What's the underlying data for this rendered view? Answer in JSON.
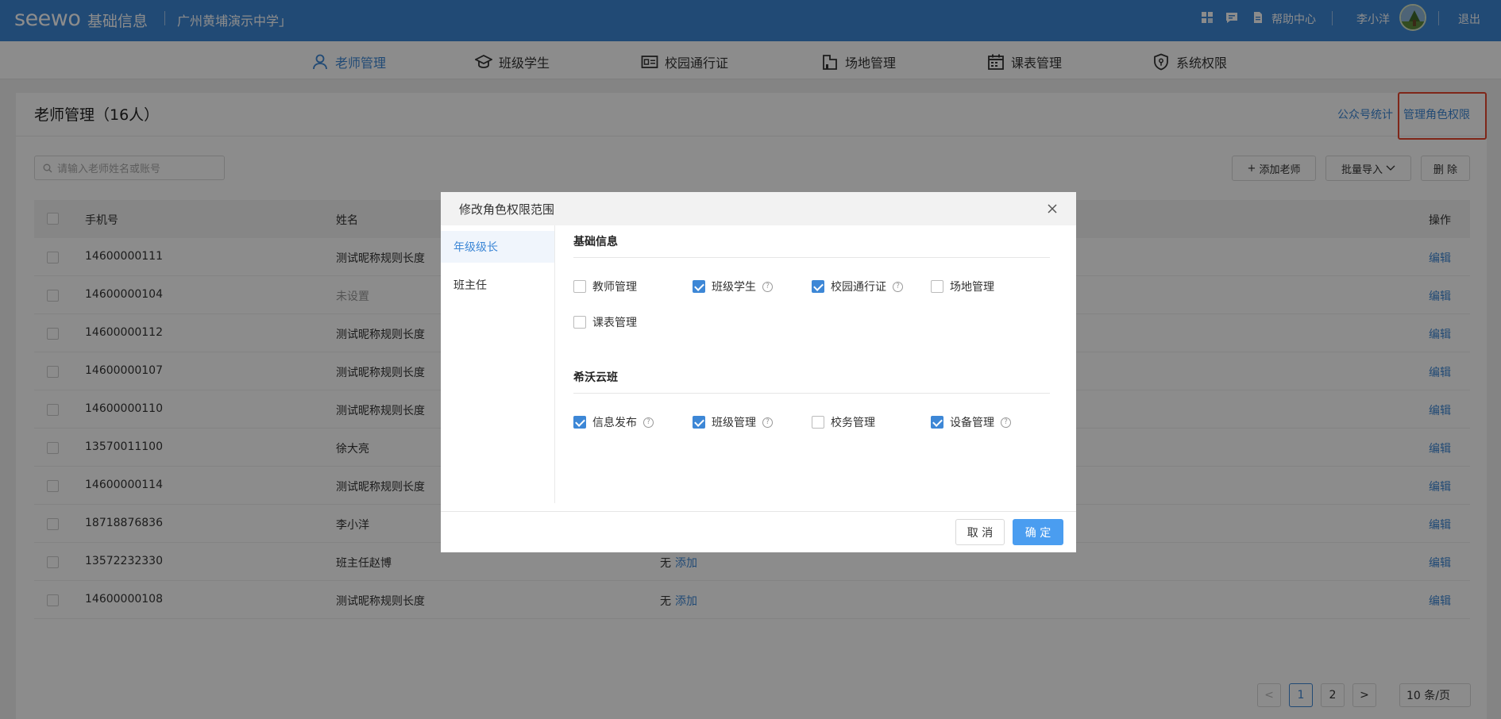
{
  "topbar": {
    "logo": "seewo",
    "app_name": "基础信息",
    "school": "广州黄埔演示中学」",
    "help": "帮助中心",
    "user": "李小洋",
    "logout": "退出"
  },
  "nav": {
    "items": [
      {
        "label": "老师管理",
        "icon": "user-icon",
        "active": true
      },
      {
        "label": "班级学生",
        "icon": "graduation-cap-icon",
        "active": false
      },
      {
        "label": "校园通行证",
        "icon": "id-card-icon",
        "active": false
      },
      {
        "label": "场地管理",
        "icon": "building-icon",
        "active": false
      },
      {
        "label": "课表管理",
        "icon": "calendar-icon",
        "active": false
      },
      {
        "label": "系统权限",
        "icon": "shield-icon",
        "active": false
      }
    ]
  },
  "page": {
    "title": "老师管理（16人）",
    "link_stats": "公众号统计",
    "link_role": "管理角色权限",
    "search_placeholder": "请输入老师姓名或账号",
    "btn_add": "添加老师",
    "btn_import": "批量导入",
    "btn_delete": "删 除"
  },
  "table": {
    "headers": {
      "phone": "手机号",
      "name": "姓名",
      "actions": "操作"
    },
    "rows": [
      {
        "phone": "14600000111",
        "name": "测试昵称规则长度",
        "role": "",
        "role_action": "",
        "action": "编辑"
      },
      {
        "phone": "14600000104",
        "name": "未设置",
        "role": "",
        "role_action": "",
        "action": "编辑",
        "name_muted": true
      },
      {
        "phone": "14600000112",
        "name": "测试昵称规则长度",
        "role": "",
        "role_action": "",
        "action": "编辑"
      },
      {
        "phone": "14600000107",
        "name": "测试昵称规则长度",
        "role": "",
        "role_action": "",
        "action": "编辑"
      },
      {
        "phone": "14600000110",
        "name": "测试昵称规则长度",
        "role": "",
        "role_action": "",
        "action": "编辑"
      },
      {
        "phone": "13570011100",
        "name": "徐大亮",
        "role": "",
        "role_action": "",
        "action": "编辑"
      },
      {
        "phone": "14600000114",
        "name": "测试昵称规则长度",
        "role": "",
        "role_action": "",
        "action": "编辑"
      },
      {
        "phone": "18718876836",
        "name": "李小洋",
        "role": "",
        "role_action": "",
        "action": "编辑"
      },
      {
        "phone": "13572232330",
        "name": "班主任赵博",
        "role": "无",
        "role_action": "添加",
        "action": "编辑"
      },
      {
        "phone": "14600000108",
        "name": "测试昵称规则长度",
        "role": "无",
        "role_action": "添加",
        "action": "编辑"
      }
    ]
  },
  "pagination": {
    "prev": "<",
    "pages": [
      "1",
      "2"
    ],
    "current": "1",
    "next": ">",
    "page_size": "10 条/页"
  },
  "modal": {
    "title": "修改角色权限范围",
    "roles": [
      {
        "label": "年级级长",
        "active": true
      },
      {
        "label": "班主任",
        "active": false
      }
    ],
    "sections": [
      {
        "title": "基础信息",
        "perms": [
          {
            "label": "教师管理",
            "checked": false,
            "help": false
          },
          {
            "label": "班级学生",
            "checked": true,
            "help": true
          },
          {
            "label": "校园通行证",
            "checked": true,
            "help": true
          },
          {
            "label": "场地管理",
            "checked": false,
            "help": false
          },
          {
            "label": "课表管理",
            "checked": false,
            "help": false
          }
        ]
      },
      {
        "title": "希沃云班",
        "perms": [
          {
            "label": "信息发布",
            "checked": true,
            "help": true
          },
          {
            "label": "班级管理",
            "checked": true,
            "help": true
          },
          {
            "label": "校务管理",
            "checked": false,
            "help": false
          },
          {
            "label": "设备管理",
            "checked": true,
            "help": true
          }
        ]
      }
    ],
    "cancel": "取 消",
    "ok": "确 定"
  },
  "colors": {
    "brand": "#3d87d6",
    "highlight": "#e8462e",
    "primary_button": "#4a9df0"
  }
}
